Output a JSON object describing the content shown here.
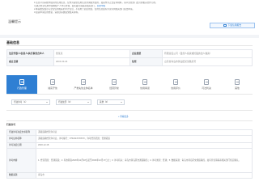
{
  "notice": {
    "label": "温馨提示",
    "lines": [
      "1.信息公示系统中展示的信用信息，仅作为提供信用信息查询服务使用，如需作为正式证明材料，请以主管部门出具的相关文件为准。",
      "可通过登录信用中国网站个人中心查询，如有疑问请联系相关部门。",
      "2.本系统仅展示与企业信用相关的公开信息，不得用于商业用途，信用信息如有异议可向相关部门提出申请。",
      "3.如需申请信用修复，请通过系统提交相关材料。"
    ],
    "link_text": "信用中国",
    "cert_button": "下载信用报告"
  },
  "basic": {
    "title": "基础信息",
    "rows": [
      [
        {
          "k": "法定代表人/负责人/执行事务合伙人",
          "v": "张某某"
        },
        {
          "k": "企业类型",
          "v": "有限责任公司（自然人投资或控股的法人独资）"
        }
      ],
      [
        {
          "k": "成立日期",
          "v": "2015-03-24"
        },
        {
          "k": "住所",
          "v": "山东省青岛市黄岛区某某路某号"
        }
      ]
    ]
  },
  "tabs": [
    {
      "label": "行政管理",
      "icon": "admin-icon",
      "active": true
    },
    {
      "label": "诚实守信",
      "icon": "integrity-icon",
      "active": false
    },
    {
      "label": "严重失信主体名单",
      "icon": "blacklist-icon",
      "active": false
    },
    {
      "label": "经营异常",
      "icon": "abnormal-icon",
      "active": false
    },
    {
      "label": "信用承诺",
      "icon": "promise-icon",
      "active": false
    },
    {
      "label": "信用评价",
      "icon": "evaluation-icon",
      "active": false
    },
    {
      "label": "司法判决",
      "icon": "judgment-icon",
      "active": false
    },
    {
      "label": "其他",
      "icon": "other-icon",
      "active": false
    }
  ],
  "filters": [
    {
      "value": "行政许可（1）"
    },
    {
      "value": "行政处罚（0）"
    },
    {
      "value": "其他（0）"
    }
  ],
  "more_link": "+ 查看更多",
  "record": {
    "header": "行政许可",
    "rows": [
      {
        "k": "行政许可决定文书名称",
        "v": "道路运输经营许可证"
      },
      {
        "k": "许可证书名称",
        "v": "道路运输经营许可证，许可编号：370211XXXXXX，许可经营范围：普通货运"
      },
      {
        "k": "许可决定日期",
        "v": "2020-12-18"
      },
      {
        "k": "许可内容",
        "v": "1. 经营范围：普通货运；2. 有效期自2020年12月18日起至2024年12月17日止；3. 许可机关：青岛市黄岛区交通运输局；4. 许可类别：普通；5. 数据来源：青岛市黄岛区交通运输局，如有异议请联系相关部门核实确认。"
      },
      {
        "k": "数据来源",
        "v": "青岛市"
      }
    ]
  }
}
